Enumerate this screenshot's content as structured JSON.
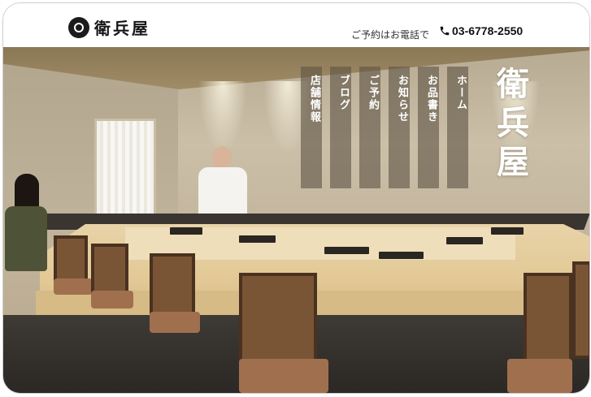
{
  "header": {
    "logo_text": "衛兵屋",
    "reserve_label": "ご予約はお電話で",
    "phone_number": "03-6778-2550"
  },
  "nav": {
    "items": [
      {
        "label": "店舗情報"
      },
      {
        "label": "ブログ"
      },
      {
        "label": "ご予約"
      },
      {
        "label": "お知らせ"
      },
      {
        "label": "お品書き"
      },
      {
        "label": "ホーム"
      }
    ]
  },
  "hero": {
    "brand_vertical": "衛兵屋"
  },
  "icons": {
    "logo": "crest-logo-icon",
    "phone": "phone-icon"
  }
}
